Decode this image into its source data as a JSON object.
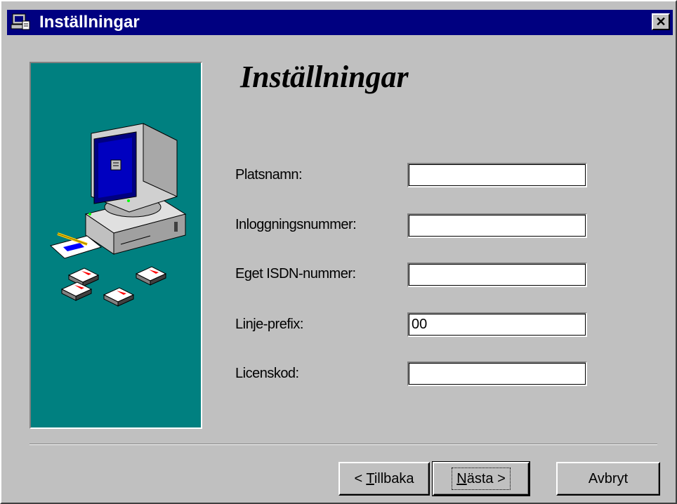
{
  "window": {
    "title": "Inställningar",
    "close_label": "✕",
    "title_icon": "setup-wizard-icon"
  },
  "heading": "Inställningar",
  "illustration": "computer-setup-illustration",
  "fields": [
    {
      "label": "Platsnamn:",
      "value": ""
    },
    {
      "label": "Inloggningsnummer:",
      "value": ""
    },
    {
      "label": "Eget ISDN-nummer:",
      "value": ""
    },
    {
      "label": "Linje-prefix:",
      "value": "00"
    },
    {
      "label": "Licenskod:",
      "value": ""
    }
  ],
  "buttons": {
    "back": {
      "prefix": "< ",
      "mnemonic": "T",
      "rest": "illbaka"
    },
    "next": {
      "mnemonic": "N",
      "rest": "ästa >"
    },
    "cancel": {
      "label": "Avbryt"
    }
  },
  "colors": {
    "titlebar": "#000080",
    "panel": "#008080",
    "face": "#c0c0c0"
  }
}
